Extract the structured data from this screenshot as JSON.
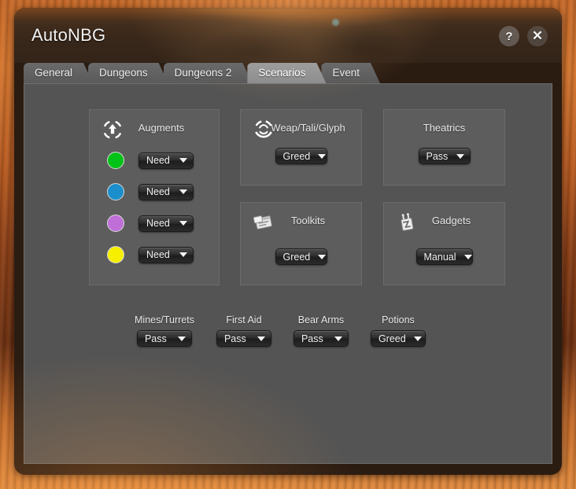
{
  "window": {
    "title": "AutoNBG",
    "help_label": "?",
    "close_label": "✕"
  },
  "tabs": [
    {
      "label": "General",
      "active": false
    },
    {
      "label": "Dungeons",
      "active": false
    },
    {
      "label": "Dungeons 2",
      "active": false
    },
    {
      "label": "Scenarios",
      "active": true
    },
    {
      "label": "Event",
      "active": false
    }
  ],
  "panels": {
    "augments": {
      "title": "Augments",
      "icon": "augment-arrow-icon",
      "rows": [
        {
          "color": "#00c217",
          "color_name": "green",
          "value": "Need"
        },
        {
          "color": "#1b8ecb",
          "color_name": "blue",
          "value": "Need"
        },
        {
          "color": "#c06fd8",
          "color_name": "purple",
          "value": "Need"
        },
        {
          "color": "#f7ef00",
          "color_name": "yellow",
          "value": "Need"
        }
      ]
    },
    "weap": {
      "title": "Weap/Tali/Glyph",
      "icon": "rune-circle-icon",
      "value": "Greed"
    },
    "theatrics": {
      "title": "Theatrics",
      "icon": "",
      "value": "Pass"
    },
    "toolkits": {
      "title": "Toolkits",
      "icon": "toolkit-icon",
      "value": "Greed"
    },
    "gadgets": {
      "title": "Gadgets",
      "icon": "gadget-icon",
      "value": "Manual"
    }
  },
  "bottom_items": [
    {
      "label": "Mines/Turrets",
      "value": "Pass"
    },
    {
      "label": "First Aid",
      "value": "Pass"
    },
    {
      "label": "Bear Arms",
      "value": "Pass"
    },
    {
      "label": "Potions",
      "value": "Greed"
    }
  ],
  "dropdown_options": [
    "Need",
    "Greed",
    "Pass",
    "Manual"
  ]
}
